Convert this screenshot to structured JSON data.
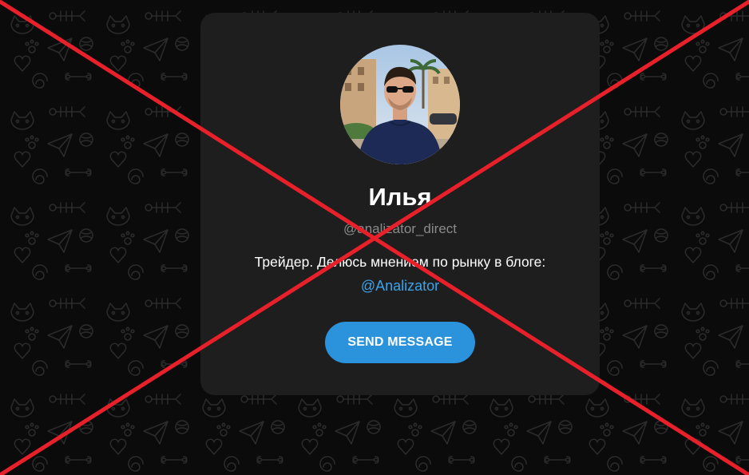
{
  "profile": {
    "name": "Илья",
    "username": "@analizator_direct",
    "bio": "Трейдер. Делюсь мнением по рынку в блоге:",
    "bio_link": "@Analizator"
  },
  "actions": {
    "send_message_label": "SEND MESSAGE"
  },
  "colors": {
    "card_bg": "#1e1e1e",
    "button": "#2a93dc",
    "link": "#3aa3ea",
    "cross": "#e8202a"
  },
  "icons": {
    "background": "doodle-pattern",
    "overlay": "red-cross-mark"
  }
}
